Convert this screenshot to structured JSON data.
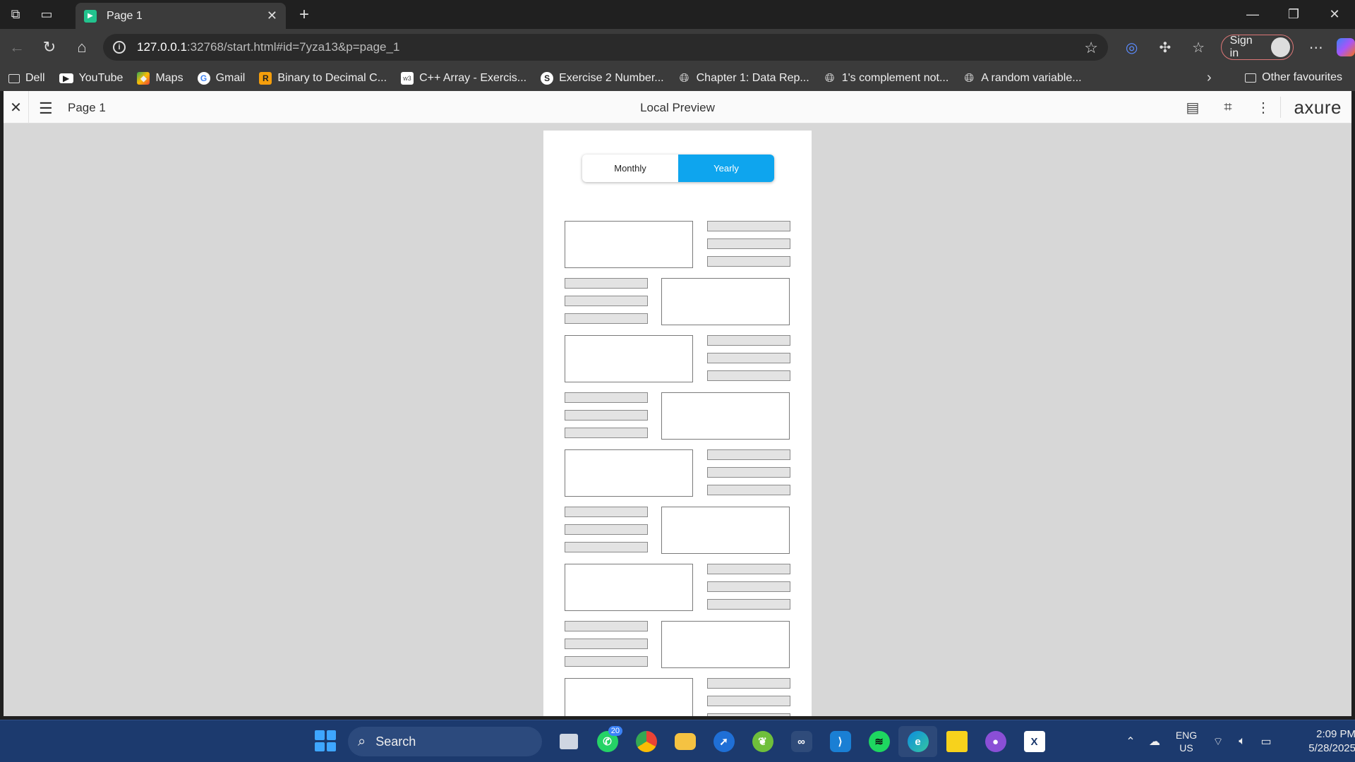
{
  "browser": {
    "tab_title": "Page 1",
    "tab_close": "✕",
    "new_tab": "+",
    "url_host": "127.0.0.1",
    "url_rest": ":32768/start.html#id=7yza13&p=page_1",
    "signin_label": "Sign in"
  },
  "bookmarks": [
    {
      "label": "Dell",
      "icon": "folder-icon"
    },
    {
      "label": "YouTube",
      "icon": "youtube-icon"
    },
    {
      "label": "Maps",
      "icon": "maps-icon"
    },
    {
      "label": "Gmail",
      "icon": "google-icon"
    },
    {
      "label": "Binary to Decimal C...",
      "icon": "r-icon"
    },
    {
      "label": "C++ Array - Exercis...",
      "icon": "w3-icon"
    },
    {
      "label": "Exercise 2 Number...",
      "icon": "s-icon"
    },
    {
      "label": "Chapter 1: Data Rep...",
      "icon": "globe-icon"
    },
    {
      "label": "1's complement not...",
      "icon": "globe-icon"
    },
    {
      "label": "A random variable...",
      "icon": "globe-icon"
    }
  ],
  "bookmarks_other": "Other favourites",
  "axure": {
    "page_label": "Page 1",
    "title": "Local Preview",
    "logo": "axure"
  },
  "prototype": {
    "toggle": {
      "monthly": "Monthly",
      "yearly": "Yearly",
      "selected": "Yearly"
    }
  },
  "taskbar": {
    "search_label": "Search",
    "whatsapp_badge": "20",
    "lang_line1": "ENG",
    "lang_line2": "US",
    "time": "2:09 PM",
    "date": "5/28/2025"
  },
  "colors": {
    "accent": "#0ea5ee",
    "taskbar": "#1c3a6e",
    "canvas": "#d7d7d7"
  }
}
